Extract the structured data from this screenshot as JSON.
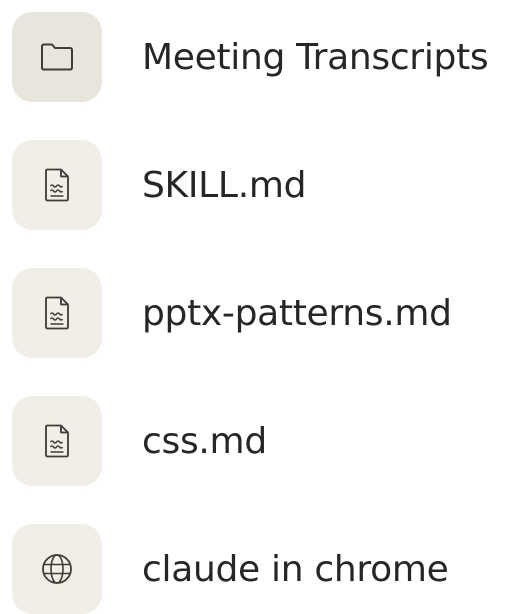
{
  "items": [
    {
      "label": "Meeting Transcripts",
      "icon": "folder-icon"
    },
    {
      "label": "SKILL.md",
      "icon": "document-icon"
    },
    {
      "label": "pptx-patterns.md",
      "icon": "document-icon"
    },
    {
      "label": "css.md",
      "icon": "document-icon"
    },
    {
      "label": "claude in chrome",
      "icon": "globe-icon"
    }
  ],
  "colors": {
    "tile_background": "#f0eee6",
    "tile_background_selected": "#e8e6dc",
    "text": "#262624",
    "icon_stroke": "#3d3d3a"
  }
}
